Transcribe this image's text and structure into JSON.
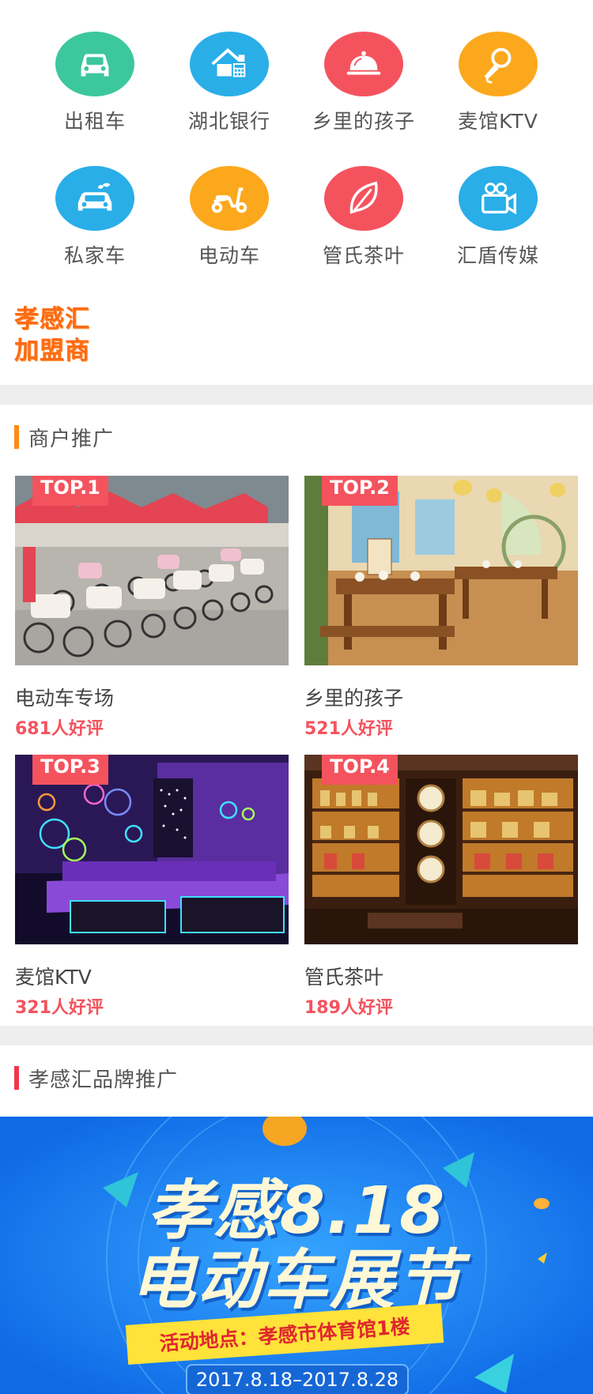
{
  "categories": [
    {
      "label": "出租车",
      "icon": "taxi-icon",
      "color": "#3cc79d"
    },
    {
      "label": "湖北银行",
      "icon": "bank-icon",
      "color": "#29aee8"
    },
    {
      "label": "乡里的孩子",
      "icon": "cloche-icon",
      "color": "#f4535e"
    },
    {
      "label": "麦馆KTV",
      "icon": "microphone-icon",
      "color": "#fca81d"
    },
    {
      "label": "私家车",
      "icon": "car-icon",
      "color": "#29aee8"
    },
    {
      "label": "电动车",
      "icon": "scooter-icon",
      "color": "#fca81d"
    },
    {
      "label": "管氏茶叶",
      "icon": "leaf-icon",
      "color": "#f4535e"
    },
    {
      "label": "汇盾传媒",
      "icon": "video-camera-icon",
      "color": "#29aee8"
    }
  ],
  "franchise": {
    "line1": "孝感汇",
    "line2": "加盟商",
    "color": "#ff6a13"
  },
  "merchant_section": {
    "title": "商户推广",
    "bar_color": "#ff8a16"
  },
  "merchants": [
    {
      "tag": "TOP.1",
      "name": "电动车专场",
      "reviews": "681人好评",
      "image": "electric-bikes-photo"
    },
    {
      "tag": "TOP.2",
      "name": "乡里的孩子",
      "reviews": "521人好评",
      "image": "restaurant-photo"
    },
    {
      "tag": "TOP.3",
      "name": "麦馆KTV",
      "reviews": "321人好评",
      "image": "ktv-photo"
    },
    {
      "tag": "TOP.4",
      "name": "管氏茶叶",
      "reviews": "189人好评",
      "image": "tea-shop-photo"
    }
  ],
  "brand_section": {
    "title": "孝感汇品牌推广",
    "bar_color": "#f4364a"
  },
  "banner": {
    "line1": "孝感8.18",
    "line2": "电动车展节",
    "location": "活动地点：孝感市体育馆1楼",
    "dates": "2017.8.18–2017.8.28"
  }
}
